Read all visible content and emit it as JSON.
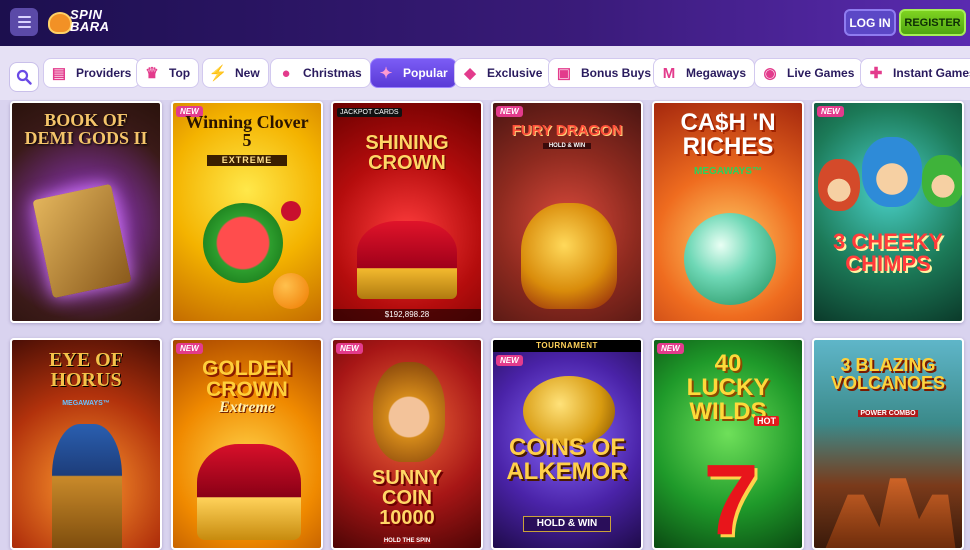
{
  "header": {
    "logo_text_top": "SPIN",
    "logo_text_bottom": "BARA",
    "login_label": "LOG IN",
    "register_label": "REGISTER"
  },
  "categories": [
    {
      "label": "Providers",
      "icon": "providers-icon"
    },
    {
      "label": "Top",
      "icon": "crown-icon"
    },
    {
      "label": "New",
      "icon": "lightning-icon"
    },
    {
      "label": "Christmas",
      "icon": "ornament-icon"
    },
    {
      "label": "Popular",
      "icon": "fire-icon",
      "active": true
    },
    {
      "label": "Exclusive",
      "icon": "diamond-icon"
    },
    {
      "label": "Bonus Buys",
      "icon": "gift-icon"
    },
    {
      "label": "Megaways",
      "icon": "megaways-icon"
    },
    {
      "label": "Live Games",
      "icon": "live-icon"
    },
    {
      "label": "Instant Games",
      "icon": "gamepad-icon"
    }
  ],
  "games": [
    {
      "title": "BOOK OF DEMI GODS II",
      "new": false
    },
    {
      "title": "Winning Clover 5",
      "subtitle": "EXTREME",
      "new": true
    },
    {
      "title": "SHINING CROWN",
      "top_label": "JACKPOT CARDS",
      "jackpot": "$192,898.28",
      "new": false
    },
    {
      "title": "FURY DRAGON",
      "subtitle": "HOLD & WIN",
      "new": true
    },
    {
      "title": "CA$H 'N RICHES",
      "subtitle": "MEGAWAYS™",
      "new": false
    },
    {
      "title": "3 CHEEKY CHIMPS",
      "new": true
    },
    {
      "title": "EYE OF HORUS",
      "subtitle": "MEGAWAYS™",
      "new": false
    },
    {
      "title": "GOLDEN CROWN",
      "subtitle": "Extreme",
      "new": true
    },
    {
      "title": "SUNNY COIN 10000",
      "subtitle": "HOLD THE SPIN",
      "new": true
    },
    {
      "title": "COINS OF ALKEMOR",
      "subtitle": "HOLD & WIN",
      "top_label": "TOURNAMENT",
      "new": true
    },
    {
      "title": "40 LUCKY WILDS",
      "subtitle": "HOT",
      "new": true
    },
    {
      "title": "3 BLAZING VOLCANOES",
      "subtitle": "POWER COMBO",
      "new": false
    }
  ],
  "badge_new": "NEW",
  "colors": {
    "header": "#2a1766",
    "active_tab": "#6a4ae6",
    "register": "#6cc51a"
  }
}
